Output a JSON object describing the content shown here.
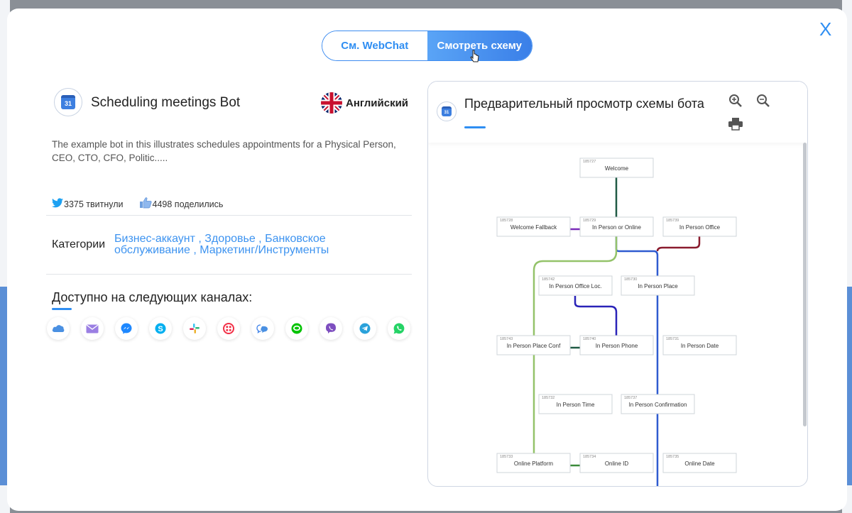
{
  "modal": {
    "close_label": "X",
    "tabs": {
      "webchat": "См. WebChat",
      "scheme": "Смотреть схему"
    }
  },
  "bot": {
    "title": "Scheduling meetings Bot",
    "icon_day": "31",
    "language": "Английский",
    "description": "The example bot in this illustrates schedules appointments for a Physical Person, CEO, CTO, CFO, Politic.....",
    "tweets": "3375 твитнули",
    "shares": "4498 поделились",
    "categories_label": "Категории",
    "categories": "Бизнес-аккаунт , Здоровье , Банковское обслуживание , Маркетинг/Инструменты",
    "channels_title": "Доступно на следующих каналах:",
    "channels": [
      {
        "name": "cloud",
        "color": "#4a90e2"
      },
      {
        "name": "email",
        "color": "#8e6fd9"
      },
      {
        "name": "messenger",
        "color": "#1e88ff"
      },
      {
        "name": "skype",
        "color": "#00aff0"
      },
      {
        "name": "slack",
        "color": "#e01e5a"
      },
      {
        "name": "twilio",
        "color": "#f22f46"
      },
      {
        "name": "webchat",
        "color": "#3a7fe8"
      },
      {
        "name": "line",
        "color": "#00c300"
      },
      {
        "name": "viber",
        "color": "#7d4ebf"
      },
      {
        "name": "telegram",
        "color": "#2aa1da"
      },
      {
        "name": "whatsapp",
        "color": "#25d366"
      }
    ]
  },
  "preview": {
    "title": "Предварительный просмотр схемы бота",
    "nodes": [
      {
        "id": "185727",
        "label": "Welcome"
      },
      {
        "id": "185728",
        "label": "Welcome Fallback"
      },
      {
        "id": "185729",
        "label": "In Person or Online"
      },
      {
        "id": "185739",
        "label": "In Person Office"
      },
      {
        "id": "185742",
        "label": "In Person Office Loc."
      },
      {
        "id": "185730",
        "label": "In Person Place"
      },
      {
        "id": "185743",
        "label": "In Person Place Conf"
      },
      {
        "id": "185740",
        "label": "In Person Phone"
      },
      {
        "id": "185731",
        "label": "In Person Date"
      },
      {
        "id": "185732",
        "label": "In Person Time"
      },
      {
        "id": "185737",
        "label": "In Person Confirmation"
      },
      {
        "id": "185733",
        "label": "Online Platform"
      },
      {
        "id": "185734",
        "label": "Online ID"
      },
      {
        "id": "185735",
        "label": "Online Date"
      }
    ]
  }
}
